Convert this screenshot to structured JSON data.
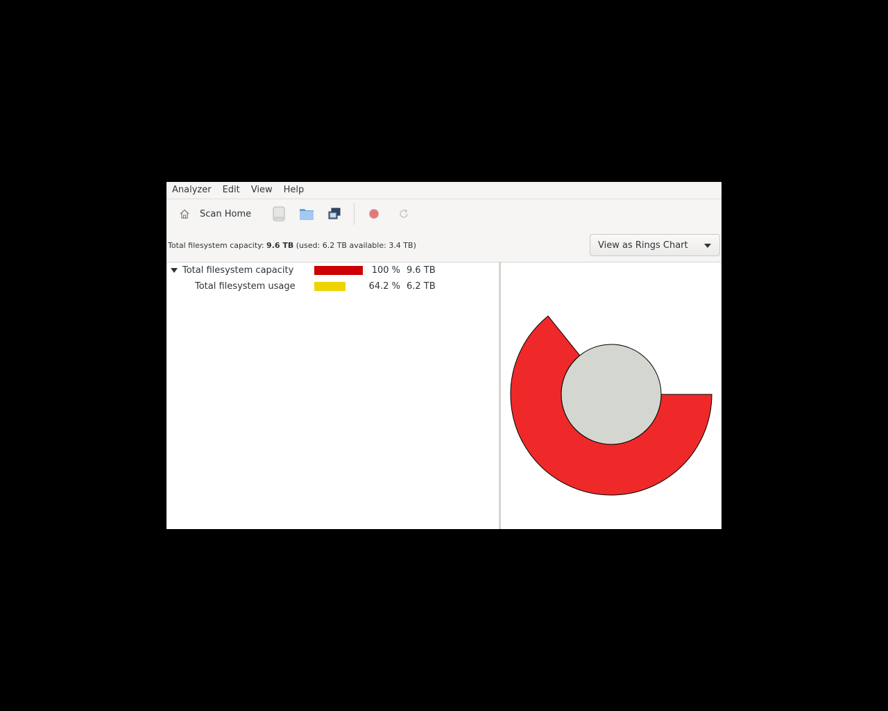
{
  "menu": [
    "Analyzer",
    "Edit",
    "View",
    "Help"
  ],
  "toolbar": {
    "scan_home_label": "Scan Home",
    "icons": [
      "home-icon",
      "disk-icon",
      "folder-icon",
      "remote-folder-icon",
      "stop-icon",
      "refresh-icon"
    ]
  },
  "info": {
    "prefix": "Total filesystem capacity: ",
    "capacity": "9.6 TB",
    "detail": " (used: 6.2 TB available: 3.4 TB)"
  },
  "view_select": {
    "selected": "View as Rings Chart"
  },
  "tree": {
    "rows": [
      {
        "name": "Total filesystem capacity",
        "percent": "100 %",
        "size": "9.6 TB",
        "fraction": 1.0,
        "color": "#cc0000"
      },
      {
        "name": "Total filesystem usage",
        "percent": "64.2 %",
        "size": "6.2 TB",
        "fraction": 0.642,
        "color": "#edd400"
      }
    ]
  },
  "rings_chart": {
    "center_color": "#d3d7cf",
    "ring_color": "#ef2929",
    "segments": [
      {
        "label": "Total filesystem usage",
        "fraction": 0.642
      }
    ]
  }
}
